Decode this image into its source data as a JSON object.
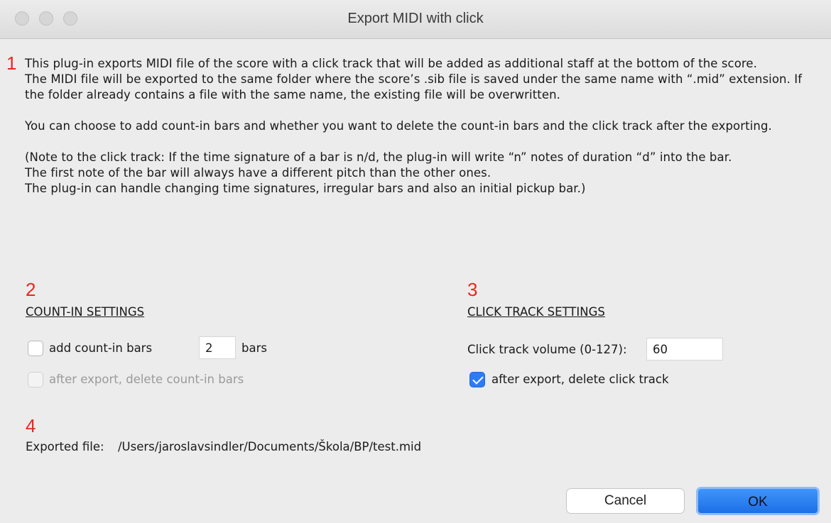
{
  "window": {
    "title": "Export MIDI with click"
  },
  "markers": {
    "one": "1",
    "two": "2",
    "three": "3",
    "four": "4"
  },
  "intro": {
    "p1": "This plug-in exports MIDI file of the score with a click track that will be added as additional staff at the bottom of the score.",
    "p2": "The MIDI file will be exported to the same folder where the score’s .sib file is saved under the same name with “.mid” extension. If the folder already contains a file with the same name, the existing file will be overwritten.",
    "p3": "You can choose to add count-in bars and whether you want to delete the count-in bars and the click track after the exporting.",
    "p4a": "(Note to the click track: If the time signature of a bar is n/d, the plug-in will write “n” notes of duration “d” into the bar.",
    "p4b": "The first note of the bar will always have a different pitch than the other ones.",
    "p4c": "The plug-in can handle changing time signatures, irregular bars and also an initial pickup bar.)"
  },
  "count_in": {
    "heading": "COUNT-IN SETTINGS",
    "add_label": "add count-in bars",
    "add_checked": false,
    "bars_value": "2",
    "bars_unit": "bars",
    "delete_label": "after export, delete count-in bars",
    "delete_checked": false,
    "delete_enabled": false
  },
  "click_track": {
    "heading": "CLICK TRACK SETTINGS",
    "volume_label": "Click track volume (0-127):",
    "volume_value": "60",
    "delete_label": "after export, delete click track",
    "delete_checked": true
  },
  "export": {
    "label": "Exported file:",
    "path": "/Users/jaroslavsindler/Documents/Škola/BP/test.mid"
  },
  "buttons": {
    "cancel": "Cancel",
    "ok": "OK"
  },
  "colors": {
    "accent": "#2d7cf6",
    "marker": "#e8281e"
  }
}
